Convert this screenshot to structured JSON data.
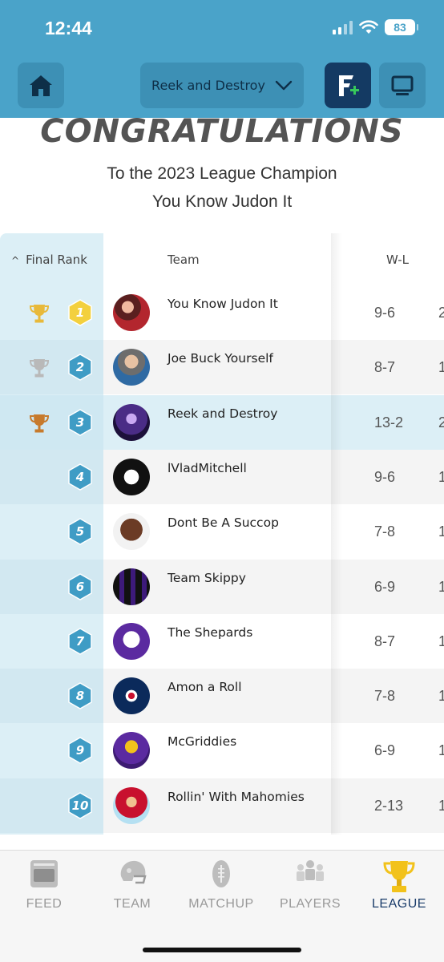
{
  "status_bar": {
    "time": "12:44",
    "battery": "83"
  },
  "header": {
    "league_name": "Reek and Destroy"
  },
  "banner": {
    "title": "CONGRATULATIONS",
    "line1": "To the 2023 League Champion",
    "line2": "You Know Judon It"
  },
  "table": {
    "columns": {
      "rank": "Final Rank",
      "team": "Team",
      "wl": "W-L"
    },
    "rows": [
      {
        "rank": "1",
        "team": "You Know Judon It",
        "wl": "9-6",
        "trophy": "gold",
        "highlight": false
      },
      {
        "rank": "2",
        "team": "Joe Buck Yourself",
        "wl": "8-7",
        "trophy": "silver",
        "highlight": false
      },
      {
        "rank": "3",
        "team": "Reek and Destroy",
        "wl": "13-2",
        "trophy": "bronze",
        "highlight": true
      },
      {
        "rank": "4",
        "team": "lVladMitchell",
        "wl": "9-6",
        "trophy": "",
        "highlight": false
      },
      {
        "rank": "5",
        "team": "Dont Be A Succop",
        "wl": "7-8",
        "trophy": "",
        "highlight": false
      },
      {
        "rank": "6",
        "team": "Team Skippy",
        "wl": "6-9",
        "trophy": "",
        "highlight": false
      },
      {
        "rank": "7",
        "team": "The Shepards",
        "wl": "8-7",
        "trophy": "",
        "highlight": false
      },
      {
        "rank": "8",
        "team": "Amon a Roll",
        "wl": "7-8",
        "trophy": "",
        "highlight": false
      },
      {
        "rank": "9",
        "team": "McGriddies",
        "wl": "6-9",
        "trophy": "",
        "highlight": false
      },
      {
        "rank": "10",
        "team": "Rollin' With Mahomies",
        "wl": "2-13",
        "trophy": "",
        "highlight": false
      }
    ],
    "next_column_partial": [
      "2",
      "1",
      "2",
      "1",
      "1",
      "1",
      "1",
      "1",
      "1",
      "1"
    ]
  },
  "tabs": [
    {
      "label": "FEED",
      "icon": "feed-icon",
      "active": false
    },
    {
      "label": "TEAM",
      "icon": "helmet-icon",
      "active": false
    },
    {
      "label": "MATCHUP",
      "icon": "football-icon",
      "active": false
    },
    {
      "label": "PLAYERS",
      "icon": "players-icon",
      "active": false
    },
    {
      "label": "LEAGUE",
      "icon": "trophy-icon",
      "active": true
    }
  ],
  "colors": {
    "header_bg": "#4aa3c9",
    "rank_col_bg": "#dceff6",
    "highlight_row": "#dceff6",
    "hex_blue": "#3f9cc5",
    "hex_gold": "#f3d03e",
    "trophy_gold": "#e8b93a",
    "trophy_silver": "#b9b9b9",
    "trophy_bronze": "#c77a2c",
    "active_tab": "#1a3c6a"
  }
}
